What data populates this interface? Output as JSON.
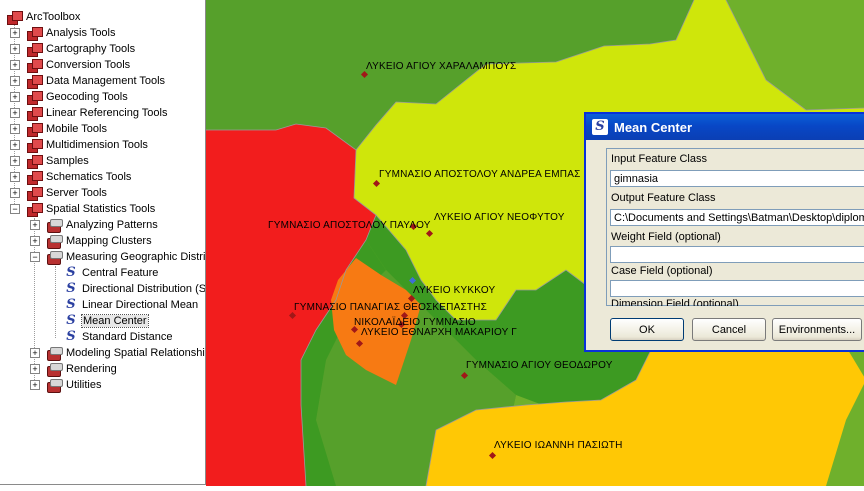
{
  "tree": {
    "root": "ArcToolbox",
    "toolboxes": [
      "Analysis Tools",
      "Cartography Tools",
      "Conversion Tools",
      "Data Management Tools",
      "Geocoding Tools",
      "Linear Referencing Tools",
      "Mobile Tools",
      "Multidimension Tools",
      "Samples",
      "Schematics Tools",
      "Server Tools",
      "Spatial Statistics Tools"
    ],
    "spatial_children": [
      "Analyzing Patterns",
      "Mapping Clusters",
      "Measuring Geographic Distri",
      "Modeling Spatial Relationship",
      "Rendering",
      "Utilities"
    ],
    "measuring_tools": [
      "Central Feature",
      "Directional Distribution (S",
      "Linear Directional Mean",
      "Mean Center",
      "Standard Distance"
    ],
    "selected_tool": "Mean Center"
  },
  "map": {
    "labels": [
      "ΛΥΚΕΙΟ ΑΓΙΟΥ ΧΑΡΑΛΑΜΠΟΥΣ",
      "ΓΥΜΝΑΣΙΟ ΑΠΟΣΤΟΛΟΥ ΑΝΔΡΕΑ ΕΜΠΑΣ",
      "ΓΥΜΝΑΣΙΟ ΑΠΟΣΤΟΛΟΥ ΠΑΥΛΟΥ",
      "ΛΥΚΕΙΟ ΑΓΙΟΥ ΝΕΟΦΥΤΟΥ",
      "ΛΥΚΕΙΟ ΚΥΚΚΟΥ",
      "ΓΥΜΝΑΣΙΟ ΠΑΝΑΓΙΑΣ ΘΕΟΣΚΕΠΑΣΤΗΣ",
      "ΝΙΚΟΛΑΪΔΕΙΟ ΓΥΜΝΑΣΙΟ",
      "ΛΥΚΕΙΟ ΕΘΝΑΡΧΗ ΜΑΚΑΡΙΟΥ Γ",
      "ΓΥΜΝΑΣΙΟ ΑΓΙΟΥ ΘΕΟΔΩΡΟΥ",
      "ΛΥΚΕΙΟ ΙΩΑΝΝΗ ΠΑΣΙΩΤΗ"
    ],
    "colors": {
      "dark_green": "#56a02b",
      "yellow_green": "#cfe60b",
      "red": "#f21d1d",
      "orange": "#f77a13",
      "forest": "#3d9a22",
      "amber": "#ffc805",
      "mid_green": "#6fb02c",
      "point": "#a01818",
      "mean_center": "#3f6fd8"
    }
  },
  "dialog": {
    "title": "Mean Center",
    "input_label": "Input Feature Class",
    "input_value": "gimnasia",
    "output_label": "Output Feature Class",
    "output_value": "C:\\Documents and Settings\\Batman\\Desktop\\diploma",
    "weight_label": "Weight Field (optional)",
    "weight_value": "",
    "case_label": "Case Field (optional)",
    "case_value": "",
    "dimension_label": "Dimension Field (optional)",
    "ok": "OK",
    "cancel": "Cancel",
    "environments": "Environments..."
  }
}
